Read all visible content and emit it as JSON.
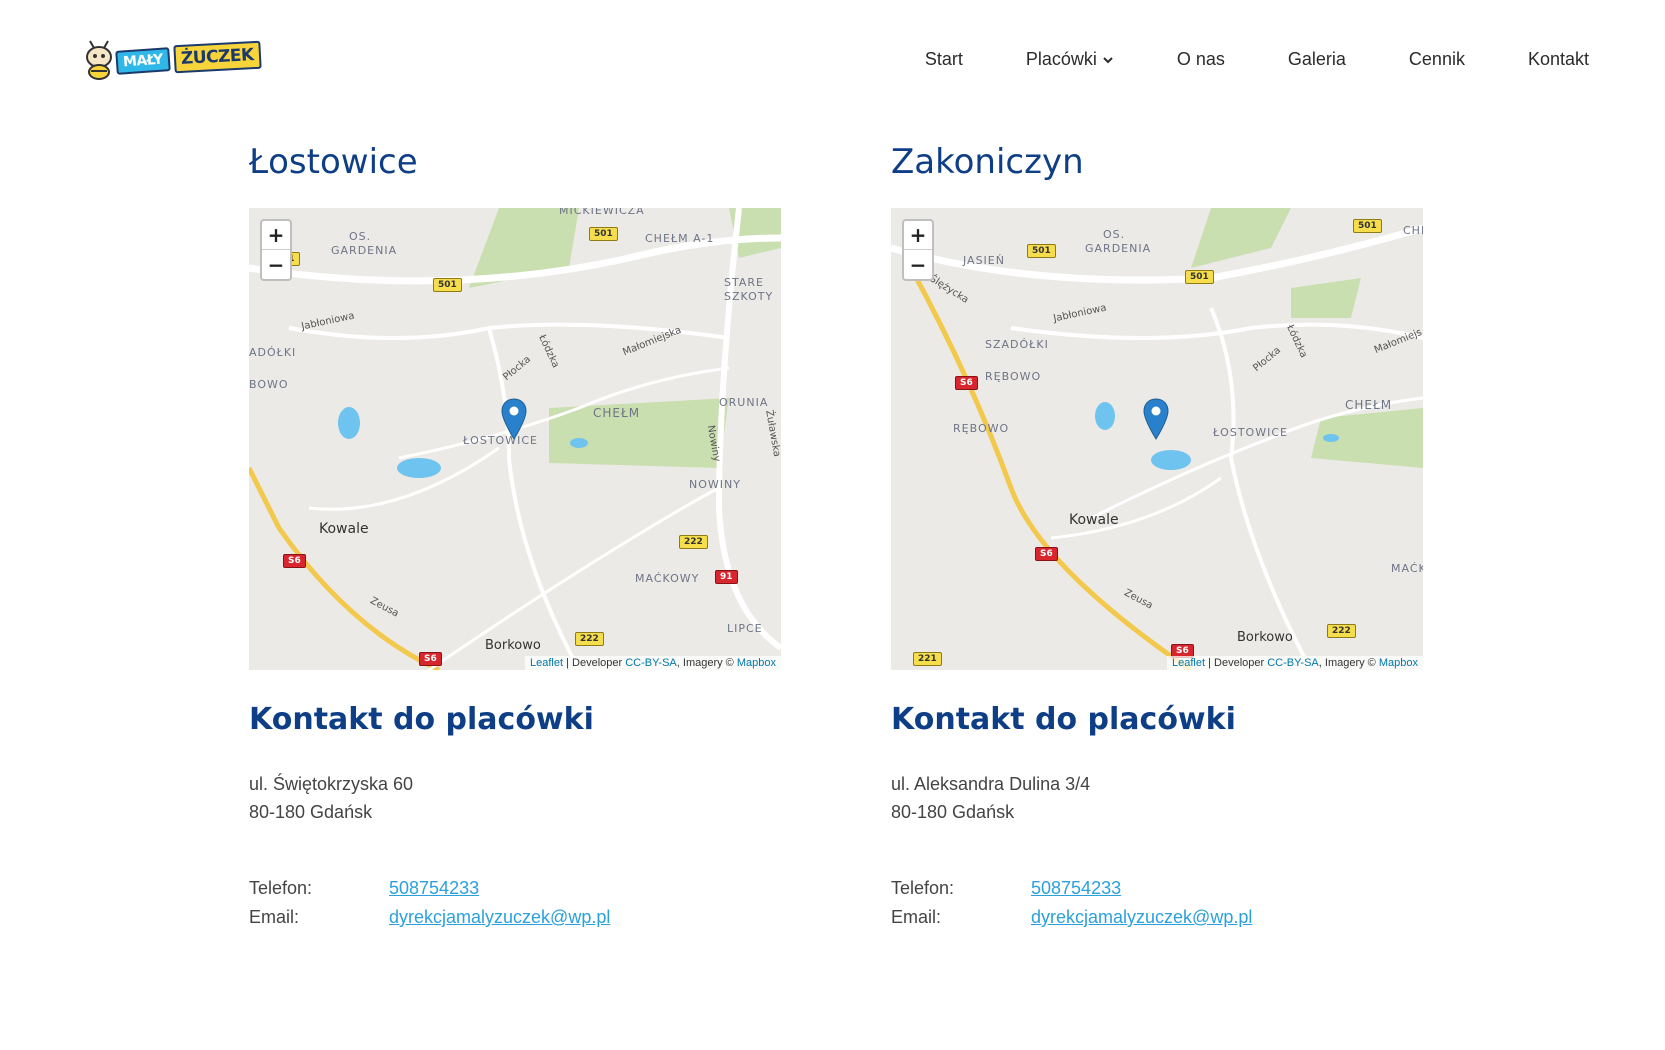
{
  "header": {
    "logo": {
      "word1": "MAŁY",
      "word2": "ŻUCZEK"
    },
    "nav": [
      {
        "label": "Start"
      },
      {
        "label": "Placówki"
      },
      {
        "label": "O nas"
      },
      {
        "label": "Galeria"
      },
      {
        "label": "Cennik"
      },
      {
        "label": "Kontakt"
      }
    ]
  },
  "locations": [
    {
      "title": "Łostowice",
      "map": {
        "zoom_in": "+",
        "zoom_out": "−",
        "attribution": {
          "leaflet": "Leaflet",
          "sep1": " | Developer ",
          "license": "CC-BY-SA",
          "sep2": ", Imagery © ",
          "provider": "Mapbox"
        },
        "labels": {
          "l1": "MICKIEWICZA",
          "l2": "OS.",
          "l3": "GARDENIA",
          "l4": "CHEŁM A-1",
          "l5": "STARE",
          "l6": "SZKOTY",
          "l7": "Jabłoniowa",
          "l8": "ADÓŁKI",
          "l9": "BOWO",
          "l10": "Płocka",
          "l11": "Łódzka",
          "l12": "Małomiejska",
          "l13": "CHEŁM",
          "l14": "ORUNIA",
          "l15": "ŁOSTOWICE",
          "l16": "Nowiny",
          "l17": "Żuławska",
          "l18": "NOWINY",
          "l19": "Kowale",
          "l20": "MAĆKOWY",
          "l21": "Zeusa",
          "l22": "LIPCE",
          "l23": "Borkowo"
        },
        "shields": {
          "s1": "501",
          "s2": "501",
          "s3": "01",
          "s4": "222",
          "s5": "91",
          "s6": "S6",
          "s7": "222",
          "s8": "S6"
        }
      },
      "contact_title": "Kontakt do placówki",
      "address_line1": "ul. Świętokrzyska 60",
      "address_line2": "80-180 Gdańsk",
      "phone_label": "Telefon:",
      "phone": "508754233",
      "email_label": "Email:",
      "email": "dyrekcjamalyzuczek@wp.pl"
    },
    {
      "title": "Zakoniczyn",
      "map": {
        "zoom_in": "+",
        "zoom_out": "−",
        "attribution": {
          "leaflet": "Leaflet",
          "sep1": " | Developer ",
          "license": "CC-BY-SA",
          "sep2": ", Imagery © ",
          "provider": "Mapbox"
        },
        "labels": {
          "l1": "OS.",
          "l2": "GARDENIA",
          "l3": "JASIEŃ",
          "l4": "CHE",
          "l5": "Ślężycka",
          "l6": "Jabłoniowa",
          "l7": "SZADÓŁKI",
          "l8": "RĘBOWO",
          "l9": "Płocka",
          "l10": "Łódzka",
          "l11": "Małomiejs",
          "l12": "RĘBOWO",
          "l13": "ŁOSTOWICE",
          "l14": "CHEŁM",
          "l15": "Kowale",
          "l16": "MAĆK",
          "l17": "Zeusa",
          "l18": "Borkowo"
        },
        "shields": {
          "s1": "501",
          "s2": "501",
          "s3": "501",
          "s4": "S6",
          "s5": "S6",
          "s6": "222",
          "s7": "221",
          "s8": "S6"
        }
      },
      "contact_title": "Kontakt do placówki",
      "address_line1": "ul. Aleksandra Dulina 3/4",
      "address_line2": "80-180 Gdańsk",
      "phone_label": "Telefon:",
      "phone": "508754233",
      "email_label": "Email:",
      "email": "dyrekcjamalyzuczek@wp.pl"
    }
  ],
  "colors": {
    "heading": "#0e3f86",
    "link": "#2ba0dc",
    "map_bg": "#eceae6",
    "pin": "#2a81cb"
  }
}
